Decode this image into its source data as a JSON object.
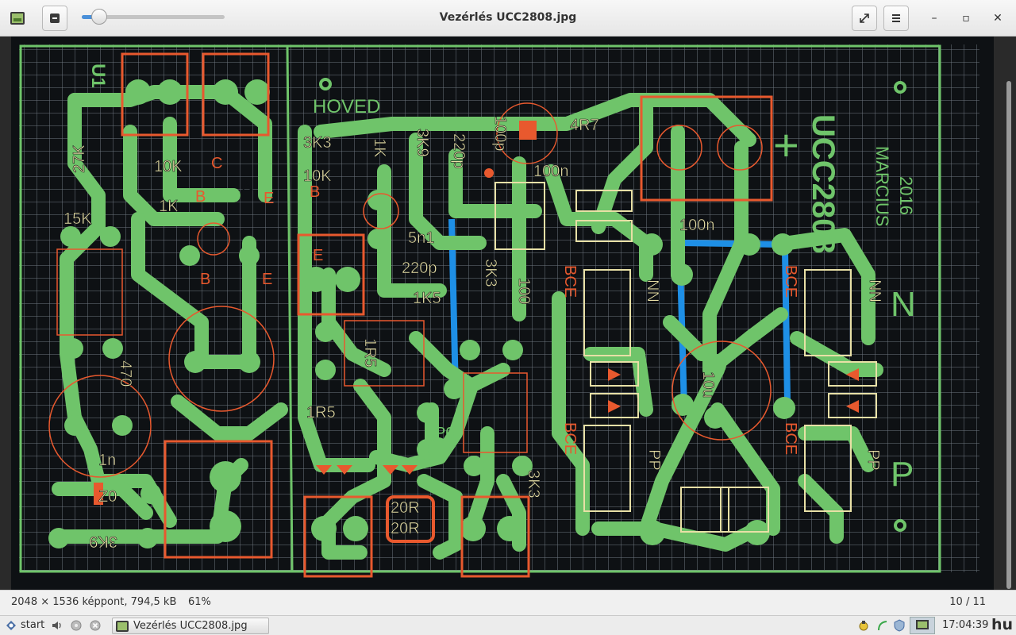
{
  "window": {
    "title": "Vezérlés UCC2808.jpg",
    "app_icon": "image-viewer-icon",
    "zoom_out_icon": "zoom-out-icon",
    "fullscreen_icon": "fullscreen-icon",
    "menu_icon": "hamburger-menu-icon",
    "minimize_label": "–",
    "maximize_label": "▫",
    "close_label": "✕"
  },
  "zoom_slider": {
    "value_fraction": 0.12
  },
  "photo": {
    "labels": {
      "hoved": "HOVED",
      "u1": "U1",
      "ucc": "UCC2808",
      "marcius": "MARCIUS",
      "year": "2016",
      "plus": "+",
      "n_big": "N",
      "p_big": "P",
      "p0": "P0",
      "3k3_a": "3K3",
      "10k_a": "10K",
      "1k_a": "1K",
      "3k9": "3K9",
      "220p": "220p",
      "4r7": "4R7",
      "100n_a": "100n",
      "100n_b": "100n",
      "100p": "100p",
      "27k": "27K",
      "10k_b": "10K",
      "1k_b": "1K",
      "15k": "15K",
      "5n1": "5n1",
      "220p_b": "220p",
      "3k3_b": "3K3",
      "1k5": "1K5",
      "100": "100",
      "1r5_a": "1R5",
      "1r5_b": "1R5",
      "470": "470",
      "1n": "1n",
      "z0": "Z0",
      "3k9_b": "3K9",
      "20r_a": "20R",
      "20r_b": "20R",
      "3k3_c": "3K3",
      "10u": "10u",
      "nn_a": "NN",
      "nn_b": "NN",
      "pp_a": "PP",
      "pp_b": "PP",
      "b": "B",
      "c": "C",
      "e": "E",
      "n": "N",
      "bce_1": "BCE",
      "bce_2": "BCE",
      "bce_3": "BCE",
      "bce_4": "BCE"
    },
    "colors": {
      "board": "#0e1114",
      "grid": "#6f7680",
      "trace": "#6fc46a",
      "silk": "#e8e0a6",
      "red": "#e8592e",
      "blue": "#1e8fe6"
    }
  },
  "status": {
    "dims": "2048 × 1536 képpont,  794,5 kB",
    "zoom": "61%",
    "index": "10 / 11"
  },
  "taskbar": {
    "start_label": "start",
    "task_label": "Vezérlés UCC2808.jpg",
    "clock": "17:04:39",
    "lang": "hu",
    "icons": [
      "start-icon",
      "volume-icon",
      "disc-icon",
      "close-circle-icon",
      "image-viewer-icon",
      "recycle-icon",
      "network-icon",
      "shield-icon",
      "monitor-icon"
    ]
  }
}
